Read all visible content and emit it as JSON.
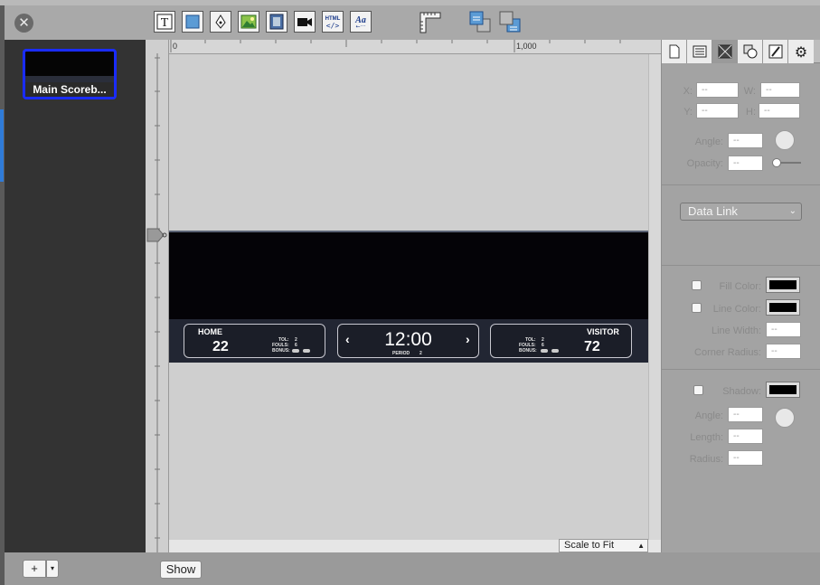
{
  "toolbar": {
    "close_icon": "close-icon",
    "tools": [
      "text-tool-icon",
      "rectangle-tool-icon",
      "pen-tool-icon",
      "image-tool-icon",
      "movie-tool-icon",
      "video-tool-icon",
      "html-tool-icon",
      "font-tool-icon"
    ],
    "html_icon_text": "HTML",
    "font_icon_text": "Aa"
  },
  "sidebar": {
    "layout_name": "Main Scoreb...",
    "add_label": "+"
  },
  "ruler": {
    "mark_0": "0",
    "mark_1000": "1,000"
  },
  "canvas": {
    "scale_option": "Scale to Fit",
    "show_label": "Show"
  },
  "scoreboard": {
    "home": {
      "name": "HOME",
      "score": "22",
      "tol_label": "TOL:",
      "tol": "2",
      "fouls_label": "FOULS:",
      "fouls": "6",
      "bonus_label": "BONUS:"
    },
    "clock": {
      "time": "12:00",
      "period_label": "PERIOD",
      "period": "2",
      "left_arrow": "‹",
      "right_arrow": "›"
    },
    "visitor": {
      "name": "VISITOR",
      "score": "72",
      "tol_label": "TOL:",
      "tol": "2",
      "fouls_label": "FOULS:",
      "fouls": "6",
      "bonus_label": "BONUS:"
    }
  },
  "inspector": {
    "tabs": [
      "document-icon",
      "list-icon",
      "frame-icon",
      "shapes-icon",
      "text-style-icon",
      "gear-icon"
    ],
    "x_label": "X:",
    "w_label": "W:",
    "y_label": "Y:",
    "h_label": "H:",
    "placeholder": "--",
    "angle_label": "Angle:",
    "opacity_label": "Opacity:",
    "data_link": "Data Link",
    "fill_color": "Fill Color:",
    "line_color": "Line Color:",
    "line_width": "Line Width:",
    "corner_radius": "Corner Radius:",
    "shadow": "Shadow:",
    "shadow_angle": "Angle:",
    "length": "Length:",
    "radius": "Radius:"
  },
  "colors": {
    "selection": "#1a2cff",
    "sidebar": "#333333",
    "scoreboard_bg": "#222633"
  }
}
